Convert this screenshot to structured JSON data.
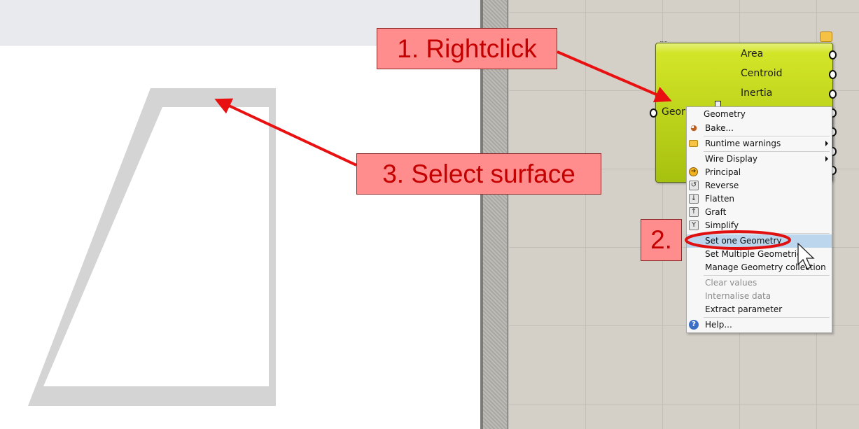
{
  "canvas": {
    "component": {
      "outputs": [
        "Area",
        "Centroid",
        "Inertia"
      ],
      "input_label": "Geometry"
    },
    "context_menu": {
      "title": "Geometry",
      "items": [
        {
          "label": "Bake...",
          "icon": "bake-icon"
        },
        {
          "label": "Runtime warnings",
          "icon": "warning-balloon-icon",
          "submenu": true
        },
        {
          "label": "Wire Display",
          "submenu": true
        },
        {
          "label": "Principal",
          "icon": "principal-icon"
        },
        {
          "label": "Reverse",
          "icon": "reverse-icon"
        },
        {
          "label": "Flatten",
          "icon": "flatten-icon"
        },
        {
          "label": "Graft",
          "icon": "graft-icon"
        },
        {
          "label": "Simplify",
          "icon": "simplify-icon"
        },
        {
          "label": "Set one Geometry",
          "highlighted": true
        },
        {
          "label": "Set Multiple Geometries"
        },
        {
          "label": "Manage Geometry collection"
        },
        {
          "label": "Clear values",
          "disabled": true
        },
        {
          "label": "Internalise data",
          "disabled": true
        },
        {
          "label": "Extract parameter"
        },
        {
          "label": "Help...",
          "icon": "help-icon"
        }
      ]
    }
  },
  "annotations": {
    "step1": "1. Rightclick",
    "step2": "2.",
    "step3": "3. Select surface"
  },
  "colors": {
    "annotation_fill": "#ff8d8d",
    "annotation_text": "#c40000",
    "arrow": "#e81010",
    "component": "#d3e527",
    "menu_highlight": "#bcd6ee"
  }
}
